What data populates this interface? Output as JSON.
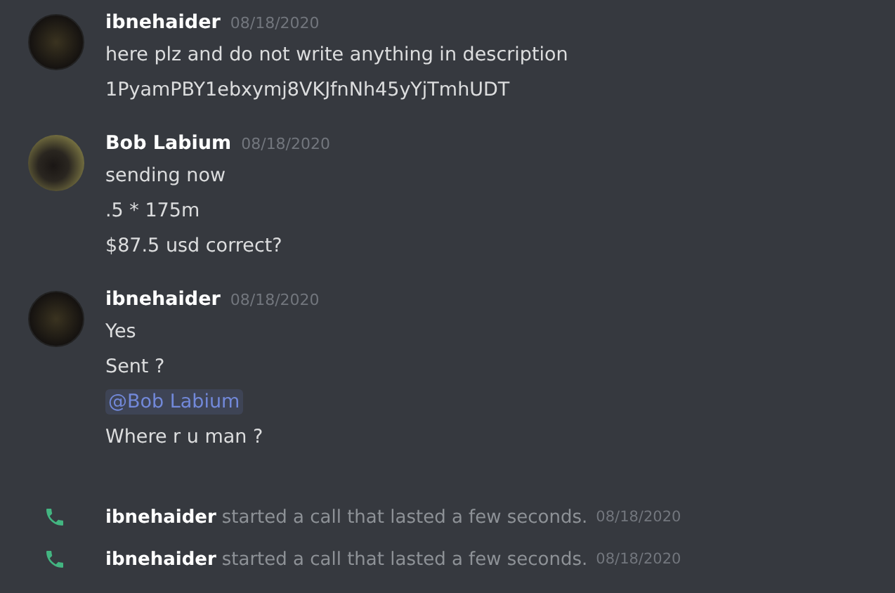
{
  "messages": [
    {
      "kind": "message",
      "author": "ibnehaider",
      "timestamp": "08/18/2020",
      "avatar": {
        "kind": "logo"
      },
      "lines": [
        {
          "kind": "text",
          "text": "here plz and do not write anything in description"
        },
        {
          "kind": "text",
          "text": "1PyamPBY1ebxymj8VKJfnNh45yYjTmhUDT"
        }
      ]
    },
    {
      "kind": "message",
      "author": "Bob Labium",
      "timestamp": "08/18/2020",
      "avatar": {
        "kind": "photo"
      },
      "lines": [
        {
          "kind": "text",
          "text": "sending now"
        },
        {
          "kind": "text",
          "text": ".5 * 175m"
        },
        {
          "kind": "text",
          "text": "$87.5 usd correct?"
        }
      ]
    },
    {
      "kind": "message",
      "author": "ibnehaider",
      "timestamp": "08/18/2020",
      "avatar": {
        "kind": "logo"
      },
      "lines": [
        {
          "kind": "text",
          "text": "Yes"
        },
        {
          "kind": "text",
          "text": "Sent ?"
        },
        {
          "kind": "mention",
          "text": "@Bob Labium"
        },
        {
          "kind": "text",
          "text": "Where r u man ?"
        }
      ]
    },
    {
      "kind": "call",
      "author": "ibnehaider",
      "text": "started a call that lasted a few seconds.",
      "timestamp": "08/18/2020"
    },
    {
      "kind": "call",
      "author": "ibnehaider",
      "text": "started a call that lasted a few seconds.",
      "timestamp": "08/18/2020"
    }
  ]
}
